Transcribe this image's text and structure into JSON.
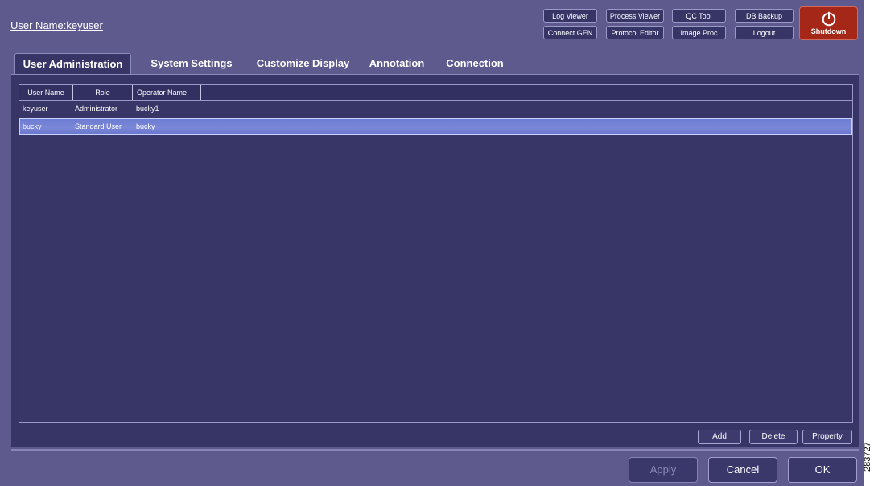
{
  "header": {
    "user_name_label": "User Name:keyuser"
  },
  "toolbar": {
    "log_viewer": "Log Viewer",
    "process_viewer": "Process Viewer",
    "qc_tool": "QC Tool",
    "db_backup": "DB Backup",
    "connect_gen": "Connect GEN",
    "protocol_editor": "Protocol Editor",
    "image_proc": "Image Proc",
    "logout": "Logout",
    "shutdown": "Shutdown"
  },
  "tabs": [
    {
      "label": "User Administration",
      "active": true
    },
    {
      "label": "System Settings",
      "active": false
    },
    {
      "label": "Customize Display",
      "active": false
    },
    {
      "label": "Annotation",
      "active": false
    },
    {
      "label": "Connection",
      "active": false
    }
  ],
  "table": {
    "columns": [
      "User Name",
      "Role",
      "Operator Name"
    ],
    "rows": [
      {
        "user_name": "keyuser",
        "role": "Administrator",
        "operator_name": "bucky1",
        "selected": false
      },
      {
        "user_name": "bucky",
        "role": "Standard User",
        "operator_name": "bucky",
        "selected": true
      }
    ]
  },
  "table_actions": {
    "add": "Add",
    "delete": "Delete",
    "property": "Property"
  },
  "footer": {
    "apply": "Apply",
    "cancel": "Cancel",
    "ok": "OK"
  },
  "figure_number": "283727",
  "colors": {
    "background": "#5e5a8e",
    "panel": "#373565",
    "selection": "#7583d6",
    "shutdown": "#a52718"
  },
  "icons": {
    "shutdown": "power-icon"
  }
}
